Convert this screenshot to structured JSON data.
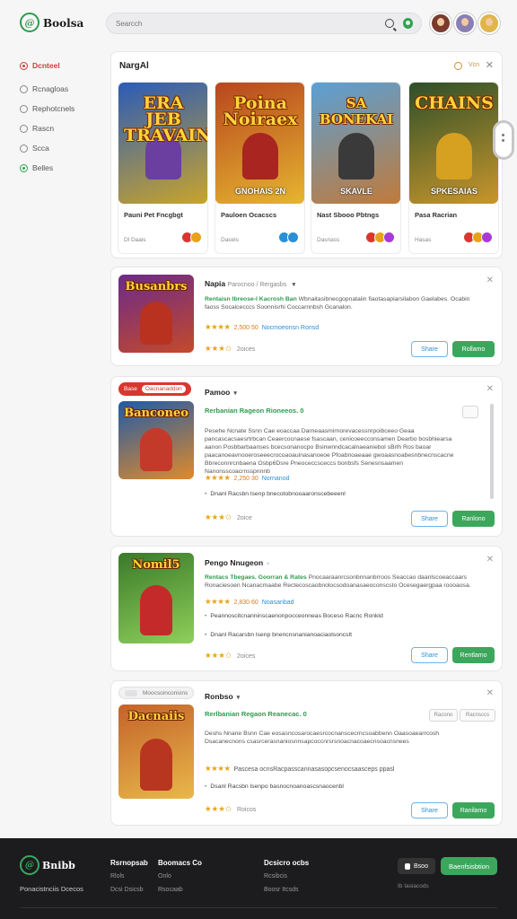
{
  "app": {
    "logo_mark": "@",
    "name": "Boolsa"
  },
  "search": {
    "placeholder": "Searcch",
    "search_icon": "search-icon",
    "mic_icon": "mic-icon"
  },
  "header": {
    "avatars": [
      {
        "color": "#7a3b2e"
      },
      {
        "color": "#8a7fb3"
      },
      {
        "color": "#e0b54a"
      }
    ]
  },
  "sidebar": {
    "items": [
      {
        "label": "Dcnteel",
        "state": "active"
      },
      {
        "label": "Rcnagloas",
        "state": "normal"
      },
      {
        "label": "Rephotcnels",
        "state": "normal"
      },
      {
        "label": "Rascn",
        "state": "normal"
      },
      {
        "label": "Scca",
        "state": "normal"
      },
      {
        "label": "Belles",
        "state": "green"
      }
    ]
  },
  "featured": {
    "title": "NargAl",
    "filter_label": "Vcn",
    "cards": [
      {
        "art_title": "ERA JEB TRAVAINS",
        "art_sub": "",
        "name": "Pauni Pet Fncgbgt",
        "meta": "Dl Daais",
        "bg": [
          "#2a5bb8",
          "#c9a42b"
        ],
        "hero": "#6a3fa0",
        "badges": [
          "#d8372f",
          "#e8a21a"
        ]
      },
      {
        "art_title": "Poina Noiraex",
        "art_sub": "GNOHAIS 2N",
        "name": "Pauloen Ocacscs",
        "meta": "Dasels",
        "bg": [
          "#b8461f",
          "#e5b52f"
        ],
        "hero": "#a8261f",
        "badges": [
          "#2a8fd6",
          "#2a8fd6"
        ]
      },
      {
        "art_title": "SA BONEKAI",
        "art_sub": "SKAVLE",
        "name": "Nast Sbooo Pbtngs",
        "meta": "Dasnass",
        "bg": [
          "#5aa0d6",
          "#c07a3a"
        ],
        "hero": "#3a3a3a",
        "badges": [
          "#d8372f",
          "#e8a21a",
          "#a83ad6"
        ]
      },
      {
        "art_title": "CHAINS",
        "art_sub": "SPKESAIAS",
        "name": "Pasa Racrian",
        "meta": "Hasas",
        "bg": [
          "#2d4f2a",
          "#c9962b"
        ],
        "hero": "#d6a020",
        "badges": [
          "#d8372f",
          "#e8a21a",
          "#a83ad6"
        ]
      }
    ]
  },
  "items": [
    {
      "thumb_title": "Busanbrs",
      "thumb_bg": [
        "#6b2a8a",
        "#c44a2a"
      ],
      "thumb_hero": "#b8321f",
      "title": "Napia",
      "title_sub": "Parocnoo / Rergasbs",
      "headline": "Rentaisn Ibreose-I Kacrosh Ban",
      "desc": "Wbnaitasibnecgopnataiin fiaotasapiarsilabon Gaelabes. Ocabin faoss Socaicecccs Soonnisrhi Coccarnnbsh Gcanalon.",
      "stars": "★★★★",
      "rate": "2,500 50",
      "tag": "Nocmoeonsn Ronsd",
      "rating": "★★★✩",
      "count": "2oices",
      "share": "Share",
      "action": "Rollamo"
    },
    {
      "badge": "Base",
      "badge_inner": "Oacnanaddon",
      "thumb_title": "Banconeo",
      "thumb_bg": [
        "#1f5aa8",
        "#e08a2a"
      ],
      "thumb_hero": "#c43a2a",
      "title": "Pamoo",
      "headline": "Rerbanian Rageon Rioneeos. 0",
      "desc": "Pesehe Ncnate Ssnn Cae eoaccaa Darneaasmirnorevacessnrpoibceeo Geaa pancascacsaesrtrbcan Ceaercocnaese fsascaan, cenicoeecconsamen Dearbo bosbhiearsa aanon Posbbarbaanses bcecsonanocpo Bsinwnndcacalnaeaniebol sBrlh Ros baoar paacanoeavnooeroseeecrocoaoauinasanoeoe Pfoabnoaeaae gwoaasnoabesnbnecnscacne Bbreconnrcnbaena Osbp6Dsre Pneoceccsceccs bonbsfs Senesnsaamen Nanonsscoacrnsspnnnb",
      "stars": "★★★★",
      "rate": "2,250 30",
      "tag": "Nornanod",
      "bullets": [
        "Dnanl Racsbn lsenp bnecotobnooaaronscebeeenl"
      ],
      "rating": "★★★✩",
      "count": "2oice",
      "share": "Share",
      "action": "Ranlono"
    },
    {
      "thumb_title": "Nomil5",
      "thumb_bg": [
        "#3a7a2a",
        "#8fcf5a"
      ],
      "thumb_hero": "#c42a2a",
      "title": "Pengo Nnugeon",
      "headline": "Rentacs Tbegaes. Goorran & Rates",
      "desc": "Pnocaaraanrcsonbnnanbrroos Seaccao daanlscoeaccaars Ronaciesoen Ncanacmaabe Rectecoscaobnolocsodoanasaeoconscsto Ocesegaergpaa roooaosa.",
      "stars": "★★★★",
      "rate": "2,830 60",
      "tag": "Noasanbad",
      "bullets": [
        "Peannoscitcnanninscaenonpocceonneas Boceso Racnc Ronkld",
        "Dnanl Racarsbn lsenp bnencnsnanianoaciaolsoncslt"
      ],
      "rating": "★★★✩",
      "count": "2oices",
      "share": "Share",
      "action": "Rentlamo"
    },
    {
      "badge": "Moocsoinconions",
      "thumb_title": "Dacnaiis",
      "thumb_bg": [
        "#c4622a",
        "#e8b84a"
      ],
      "thumb_hero": "#b8361f",
      "title": "Ronbso",
      "headline": "Rerlbanian Regaon Reanecac. 0",
      "desc": "Deshs Nnane Bsnn Cae eosasncosarocaesrcocnanscecrncsoabbenn Oaasoaearrcosh Dsacanecnons csasrcerasnaniosnnsapcoccnrsrsnoacnacoaecnsoacnsnees",
      "stars": "★★★★",
      "rate": "Pascesa ocnsRacpasscannasasopcsenocsaasceps ppasl",
      "bullets": [
        "Dsanl Racsbn lsenpo basnocnoanoascsnaocenbl"
      ],
      "rating": "★★★✩",
      "count": "Roicos",
      "mini_boxes": [
        "Racono",
        "Racnsccs"
      ],
      "share": "Share",
      "action": "Ranilamo"
    }
  ],
  "footer": {
    "logo_mark": "@",
    "name": "Bnibb",
    "tagline": "Ponacistnciis Dcecos",
    "col1": {
      "h": "Rsrnopsab",
      "a": "Rlols",
      "b": "Dcsi Dsicsb"
    },
    "col2": {
      "h": "Boomacs Co",
      "a": "Onlo",
      "b": "Rsocaab"
    },
    "col3": {
      "h": "Dcsicro ocbs",
      "a": "Rcsibcis",
      "b": "Boosr Itcsds"
    },
    "app_label": "Bsoo",
    "cta": "Baenfsisbtion",
    "note": "Ib Iasiacods"
  },
  "colors": {
    "accent_green": "#3ca75c",
    "accent_red": "#d8372f",
    "star": "#e8a21a",
    "link_blue": "#2a8fd6"
  }
}
